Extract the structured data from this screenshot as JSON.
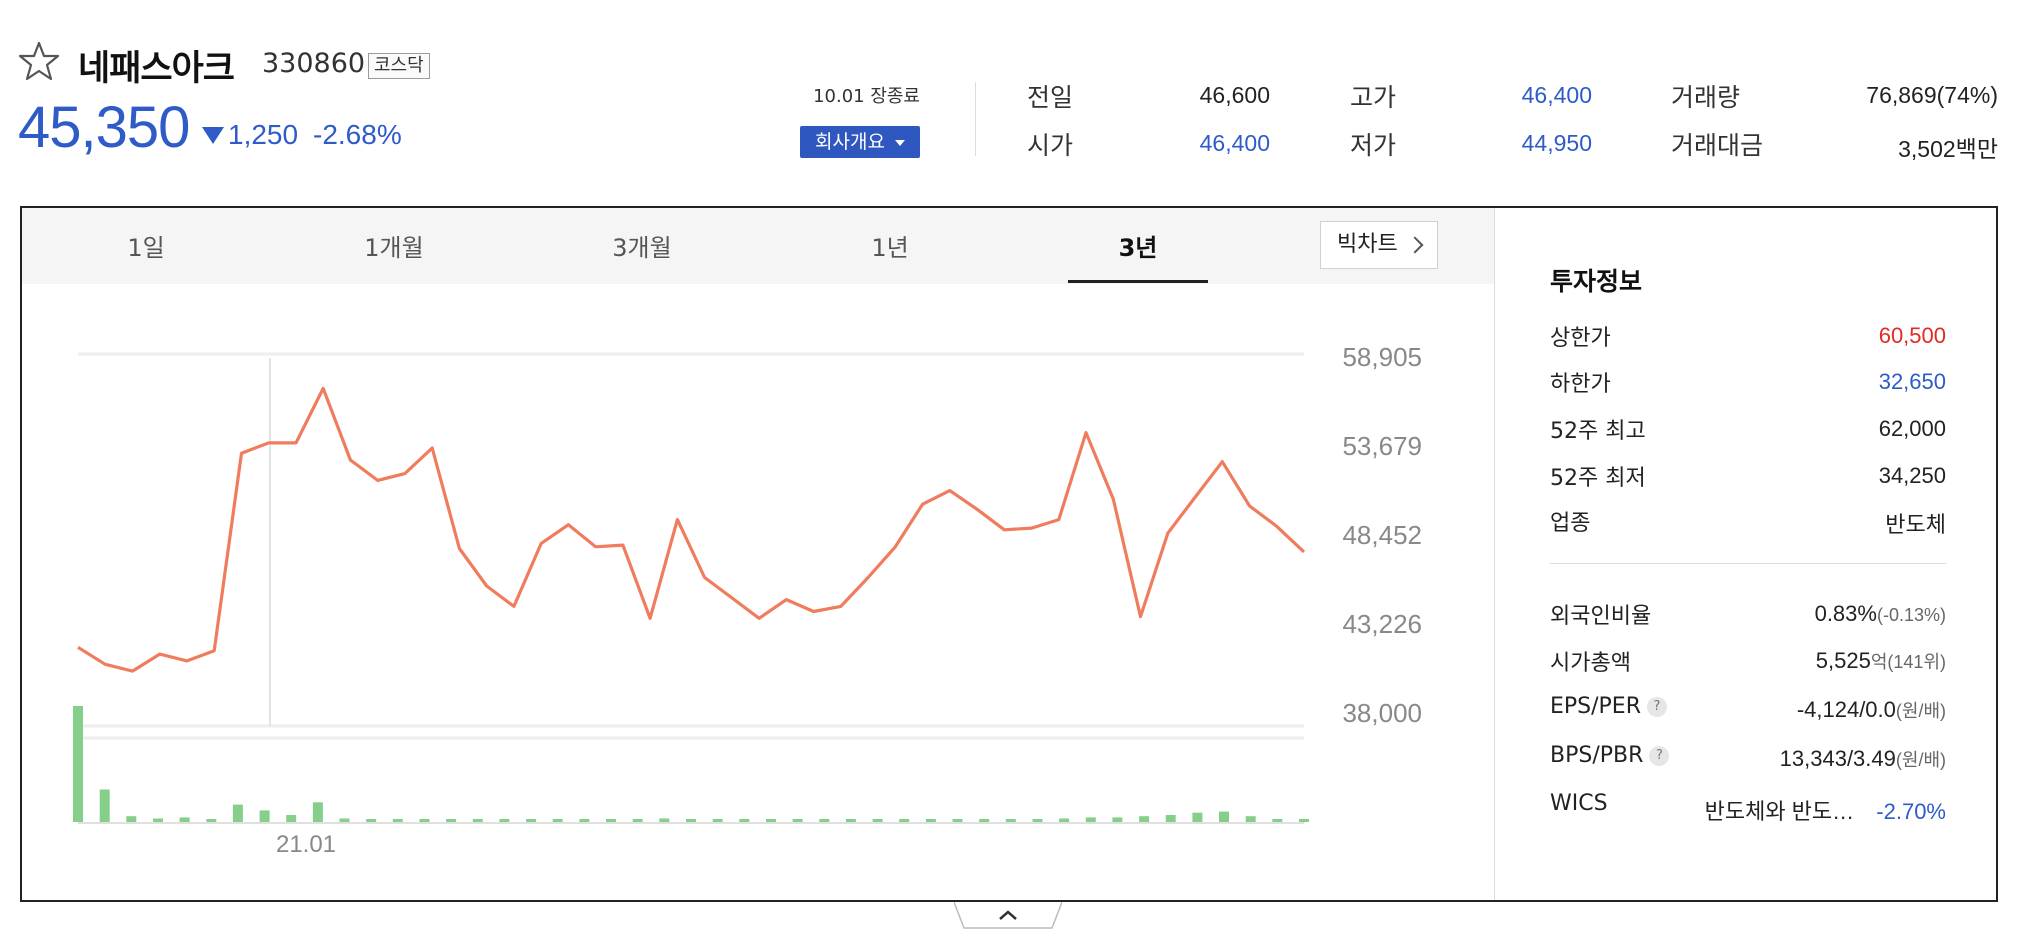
{
  "stock": {
    "name": "네패스아크",
    "code": "330860",
    "market": "코스닥",
    "price": "45,350",
    "change": "1,250",
    "change_rate": "-2.68%",
    "direction_icon": "down-triangle-icon"
  },
  "status": {
    "market_status": "10.01 장종료",
    "company_button": "회사개요"
  },
  "summary": {
    "prev_close": {
      "label": "전일",
      "value": "46,600"
    },
    "open": {
      "label": "시가",
      "value": "46,400"
    },
    "high": {
      "label": "고가",
      "value": "46,400"
    },
    "low": {
      "label": "저가",
      "value": "44,950"
    },
    "volume": {
      "label": "거래량",
      "value": "76,869(74%)"
    },
    "amount": {
      "label": "거래대금",
      "value": "3,502백만"
    }
  },
  "tabs": [
    "1일",
    "1개월",
    "3개월",
    "1년",
    "3년"
  ],
  "active_tab": "3년",
  "big_chart_label": "빅차트",
  "chart_data": {
    "type": "line",
    "y_ticks": [
      "58,905",
      "53,679",
      "48,452",
      "43,226",
      "38,000"
    ],
    "ylim": [
      38000,
      58905
    ],
    "x_label": "21.01",
    "price_values": [
      41800,
      40800,
      40400,
      41400,
      41000,
      41600,
      53200,
      53800,
      53800,
      57000,
      52800,
      51600,
      52000,
      53500,
      47600,
      45400,
      44200,
      47900,
      49000,
      47700,
      47800,
      43500,
      49300,
      45900,
      44700,
      43500,
      44600,
      43900,
      44200,
      45900,
      47700,
      50200,
      51000,
      49900,
      48700,
      48800,
      49300,
      54400,
      50500,
      43600,
      48500,
      50600,
      52700,
      50100,
      48900,
      47400
    ],
    "volume_values": [
      100,
      28,
      5,
      3,
      4,
      1,
      15,
      10,
      6,
      17,
      3,
      1,
      1,
      2,
      2,
      1,
      1,
      1,
      1,
      1,
      1,
      2,
      3,
      1,
      1,
      1,
      1,
      0,
      1,
      1,
      1,
      2,
      2,
      1,
      1,
      1,
      1,
      3,
      4,
      4,
      5,
      6,
      8,
      9,
      5,
      1,
      2
    ],
    "line_color": "#f07c5e",
    "volume_color": "#86cf8b"
  },
  "invest_info": {
    "title": "투자정보",
    "rows": [
      {
        "label": "상한가",
        "value": "60,500",
        "color": "red"
      },
      {
        "label": "하한가",
        "value": "32,650",
        "color": "blue"
      },
      {
        "label": "52주 최고",
        "value": "62,000",
        "color": "dark"
      },
      {
        "label": "52주 최저",
        "value": "34,250",
        "color": "dark"
      },
      {
        "label": "업종",
        "value": "반도체",
        "color": "dark"
      }
    ],
    "foreign_ratio": {
      "label": "외국인비율",
      "value": "0.83%",
      "sub": "(-0.13%)"
    },
    "market_cap": {
      "label": "시가총액",
      "value": "5,525",
      "unit": "억(141위)"
    },
    "eps_per": {
      "label": "EPS/PER",
      "value": "-4,124/0.0",
      "unit": "(원/배)",
      "help": "?"
    },
    "bps_pbr": {
      "label": "BPS/PBR",
      "value": "13,343/3.49",
      "unit": "(원/배)",
      "help": "?"
    },
    "wics": {
      "label": "WICS",
      "value": "반도체와 반도…",
      "rate": "-2.70%"
    }
  }
}
